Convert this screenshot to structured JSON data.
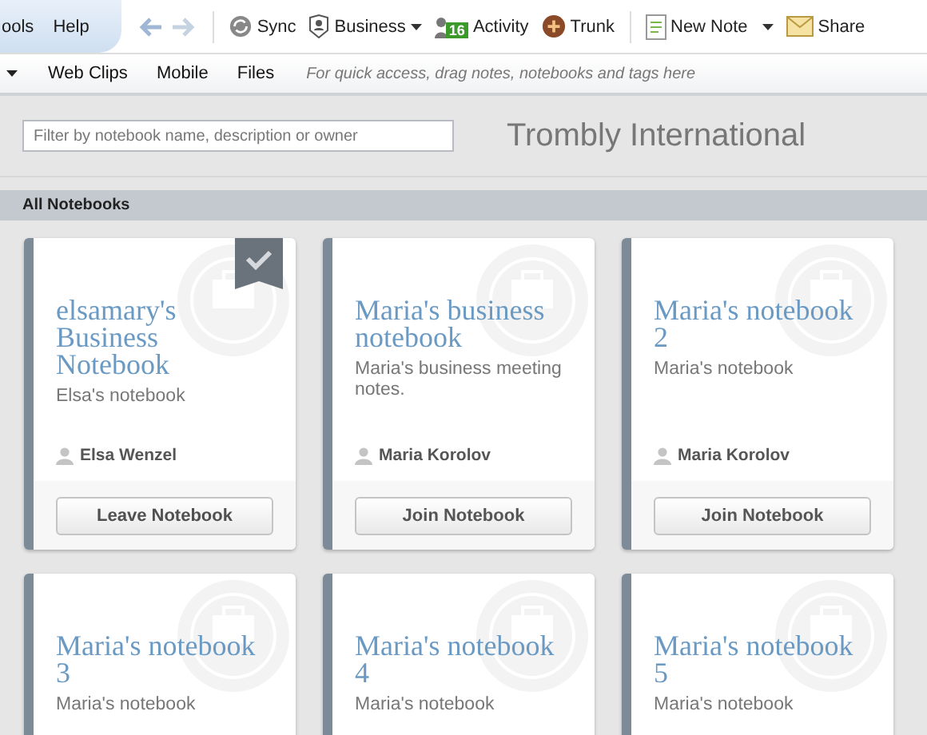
{
  "menu": [
    "ools",
    "Help"
  ],
  "toolbar": [
    {
      "kind": "sync",
      "label": "Sync"
    },
    {
      "kind": "business",
      "label": "Business"
    },
    {
      "kind": "activity",
      "label": "Activity",
      "badge": "16"
    },
    {
      "kind": "trunk",
      "label": "Trunk"
    },
    {
      "kind": "new-note",
      "label": "New Note"
    },
    {
      "kind": "share",
      "label": "Share"
    }
  ],
  "shortcuts": {
    "items": [
      "Web Clips",
      "Mobile",
      "Files"
    ],
    "hint": "For quick access, drag notes, notebooks and tags here"
  },
  "filter": {
    "placeholder": "Filter by notebook name, description or owner"
  },
  "business_name": "Trombly International",
  "section_title": "All Notebooks",
  "notebooks": [
    {
      "title": "elsamary's Business Notebook",
      "description": "Elsa's notebook",
      "owner": "Elsa Wenzel",
      "joined": true,
      "action": "Leave Notebook"
    },
    {
      "title": "Maria's business notebook",
      "description": "Maria's business meeting notes.",
      "owner": "Maria Korolov",
      "joined": false,
      "action": "Join Notebook"
    },
    {
      "title": "Maria's notebook 2",
      "description": "Maria's notebook",
      "owner": "Maria Korolov",
      "joined": false,
      "action": "Join Notebook"
    },
    {
      "title": "Maria's notebook 3",
      "description": "Maria's notebook",
      "joined": false
    },
    {
      "title": "Maria's notebook 4",
      "description": "Maria's notebook",
      "joined": false
    },
    {
      "title": "Maria's notebook 5",
      "description": "Maria's notebook",
      "joined": false
    }
  ]
}
